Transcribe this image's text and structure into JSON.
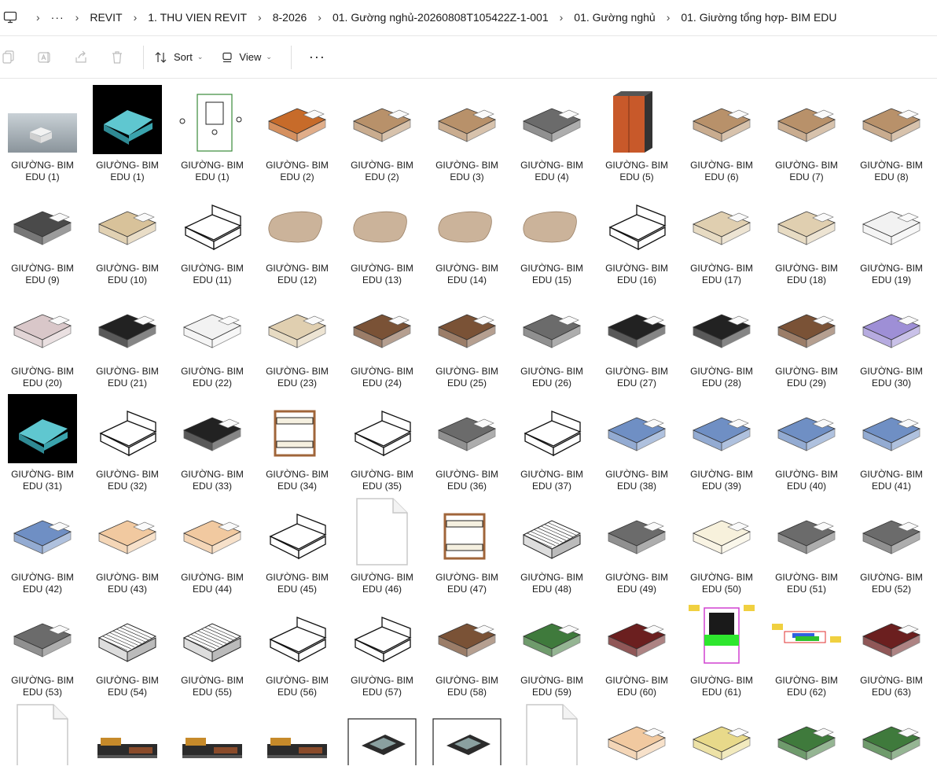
{
  "breadcrumb": {
    "items": [
      "REVIT",
      "1. THU VIEN REVIT",
      "8-2026",
      "01. Gường nghủ-20260808T105422Z-1-001",
      "01. Gường nghủ",
      "01. Giường tổng hợp- BIM EDU"
    ]
  },
  "toolbar": {
    "sort_label": "Sort",
    "view_label": "View",
    "more_label": "···"
  },
  "files": [
    {
      "line1": "GIƯỜNG- BIM",
      "line2": "EDU (1)",
      "kind": "photo"
    },
    {
      "line1": "GIƯỜNG- BIM",
      "line2": "EDU (1)",
      "kind": "dark"
    },
    {
      "line1": "GIƯỜNG- BIM",
      "line2": "EDU (1)",
      "kind": "plan"
    },
    {
      "line1": "GIƯỜNG- BIM",
      "line2": "EDU (2)",
      "kind": "orange"
    },
    {
      "line1": "GIƯỜNG- BIM",
      "line2": "EDU (2)",
      "kind": "wood"
    },
    {
      "line1": "GIƯỜNG- BIM",
      "line2": "EDU (3)",
      "kind": "wood"
    },
    {
      "line1": "GIƯỜNG- BIM",
      "line2": "EDU (4)",
      "kind": "grey"
    },
    {
      "line1": "GIƯỜNG- BIM",
      "line2": "EDU (5)",
      "kind": "cabinet"
    },
    {
      "line1": "GIƯỜNG- BIM",
      "line2": "EDU (6)",
      "kind": "wood"
    },
    {
      "line1": "GIƯỜNG- BIM",
      "line2": "EDU (7)",
      "kind": "wood"
    },
    {
      "line1": "GIƯỜNG- BIM",
      "line2": "EDU (8)",
      "kind": "wood"
    },
    {
      "line1": "GIƯỜNG- BIM",
      "line2": "EDU (9)",
      "kind": "dark-slab"
    },
    {
      "line1": "GIƯỜNG- BIM",
      "line2": "EDU (10)",
      "kind": "tan"
    },
    {
      "line1": "GIƯỜNG- BIM",
      "line2": "EDU (11)",
      "kind": "line"
    },
    {
      "line1": "GIƯỜNG- BIM",
      "line2": "EDU (12)",
      "kind": "pillow"
    },
    {
      "line1": "GIƯỜNG- BIM",
      "line2": "EDU (13)",
      "kind": "pillow"
    },
    {
      "line1": "GIƯỜNG- BIM",
      "line2": "EDU (14)",
      "kind": "pillow"
    },
    {
      "line1": "GIƯỜNG- BIM",
      "line2": "EDU (15)",
      "kind": "pillow"
    },
    {
      "line1": "GIƯỜNG- BIM",
      "line2": "EDU (16)",
      "kind": "line"
    },
    {
      "line1": "GIƯỜNG- BIM",
      "line2": "EDU (17)",
      "kind": "beige"
    },
    {
      "line1": "GIƯỜNG- BIM",
      "line2": "EDU (18)",
      "kind": "beige"
    },
    {
      "line1": "GIƯỜNG- BIM",
      "line2": "EDU (19)",
      "kind": "white"
    },
    {
      "line1": "GIƯỜNG- BIM",
      "line2": "EDU (20)",
      "kind": "pink"
    },
    {
      "line1": "GIƯỜNG- BIM",
      "line2": "EDU (21)",
      "kind": "black"
    },
    {
      "line1": "GIƯỜNG- BIM",
      "line2": "EDU (22)",
      "kind": "white"
    },
    {
      "line1": "GIƯỜNG- BIM",
      "line2": "EDU (23)",
      "kind": "beige"
    },
    {
      "line1": "GIƯỜNG- BIM",
      "line2": "EDU (24)",
      "kind": "brown"
    },
    {
      "line1": "GIƯỜNG- BIM",
      "line2": "EDU (25)",
      "kind": "brown"
    },
    {
      "line1": "GIƯỜNG- BIM",
      "line2": "EDU (26)",
      "kind": "grey"
    },
    {
      "line1": "GIƯỜNG- BIM",
      "line2": "EDU (27)",
      "kind": "black"
    },
    {
      "line1": "GIƯỜNG- BIM",
      "line2": "EDU (28)",
      "kind": "black"
    },
    {
      "line1": "GIƯỜNG- BIM",
      "line2": "EDU (29)",
      "kind": "brown"
    },
    {
      "line1": "GIƯỜNG- BIM",
      "line2": "EDU (30)",
      "kind": "purple"
    },
    {
      "line1": "GIƯỜNG- BIM",
      "line2": "EDU (31)",
      "kind": "dark"
    },
    {
      "line1": "GIƯỜNG- BIM",
      "line2": "EDU (32)",
      "kind": "line"
    },
    {
      "line1": "GIƯỜNG- BIM",
      "line2": "EDU (33)",
      "kind": "black"
    },
    {
      "line1": "GIƯỜNG- BIM",
      "line2": "EDU (34)",
      "kind": "bunk"
    },
    {
      "line1": "GIƯỜNG- BIM",
      "line2": "EDU (35)",
      "kind": "line"
    },
    {
      "line1": "GIƯỜNG- BIM",
      "line2": "EDU (36)",
      "kind": "grey"
    },
    {
      "line1": "GIƯỜNG- BIM",
      "line2": "EDU (37)",
      "kind": "line"
    },
    {
      "line1": "GIƯỜNG- BIM",
      "line2": "EDU (38)",
      "kind": "blue"
    },
    {
      "line1": "GIƯỜNG- BIM",
      "line2": "EDU (39)",
      "kind": "blue"
    },
    {
      "line1": "GIƯỜNG- BIM",
      "line2": "EDU (40)",
      "kind": "blue"
    },
    {
      "line1": "GIƯỜNG- BIM",
      "line2": "EDU (41)",
      "kind": "blue"
    },
    {
      "line1": "GIƯỜNG- BIM",
      "line2": "EDU (42)",
      "kind": "blue"
    },
    {
      "line1": "GIƯỜNG- BIM",
      "line2": "EDU (43)",
      "kind": "peach"
    },
    {
      "line1": "GIƯỜNG- BIM",
      "line2": "EDU (44)",
      "kind": "peach"
    },
    {
      "line1": "GIƯỜNG- BIM",
      "line2": "EDU (45)",
      "kind": "line"
    },
    {
      "line1": "GIƯỜNG- BIM",
      "line2": "EDU (46)",
      "kind": "file"
    },
    {
      "line1": "GIƯỜNG- BIM",
      "line2": "EDU (47)",
      "kind": "bunk"
    },
    {
      "line1": "GIƯỜNG- BIM",
      "line2": "EDU (48)",
      "kind": "mesh"
    },
    {
      "line1": "GIƯỜNG- BIM",
      "line2": "EDU (49)",
      "kind": "grey"
    },
    {
      "line1": "GIƯỜNG- BIM",
      "line2": "EDU (50)",
      "kind": "cream"
    },
    {
      "line1": "GIƯỜNG- BIM",
      "line2": "EDU (51)",
      "kind": "grey"
    },
    {
      "line1": "GIƯỜNG- BIM",
      "line2": "EDU (52)",
      "kind": "grey"
    },
    {
      "line1": "GIƯỜNG- BIM",
      "line2": "EDU (53)",
      "kind": "grey"
    },
    {
      "line1": "GIƯỜNG- BIM",
      "line2": "EDU (54)",
      "kind": "mesh"
    },
    {
      "line1": "GIƯỜNG- BIM",
      "line2": "EDU (55)",
      "kind": "mesh"
    },
    {
      "line1": "GIƯỜNG- BIM",
      "line2": "EDU (56)",
      "kind": "line"
    },
    {
      "line1": "GIƯỜNG- BIM",
      "line2": "EDU (57)",
      "kind": "line"
    },
    {
      "line1": "GIƯỜNG- BIM",
      "line2": "EDU (58)",
      "kind": "brown"
    },
    {
      "line1": "GIƯỜNG- BIM",
      "line2": "EDU (59)",
      "kind": "green"
    },
    {
      "line1": "GIƯỜNG- BIM",
      "line2": "EDU (60)",
      "kind": "maroon"
    },
    {
      "line1": "GIƯỜNG- BIM",
      "line2": "EDU (61)",
      "kind": "cad"
    },
    {
      "line1": "GIƯỜNG- BIM",
      "line2": "EDU (62)",
      "kind": "cad2"
    },
    {
      "line1": "GIƯỜNG- BIM",
      "line2": "EDU (63)",
      "kind": "maroon"
    },
    {
      "line1": "",
      "line2": "",
      "kind": "file"
    },
    {
      "line1": "",
      "line2": "",
      "kind": "sofa"
    },
    {
      "line1": "",
      "line2": "",
      "kind": "sofa"
    },
    {
      "line1": "",
      "line2": "",
      "kind": "sofa"
    },
    {
      "line1": "",
      "line2": "",
      "kind": "framed"
    },
    {
      "line1": "",
      "line2": "",
      "kind": "framed"
    },
    {
      "line1": "",
      "line2": "",
      "kind": "file"
    },
    {
      "line1": "",
      "line2": "",
      "kind": "peach"
    },
    {
      "line1": "",
      "line2": "",
      "kind": "yellow"
    },
    {
      "line1": "",
      "line2": "",
      "kind": "green"
    },
    {
      "line1": "",
      "line2": "",
      "kind": "green"
    }
  ],
  "palette": {
    "wood": "#b8916a",
    "dark": "#000000",
    "grey": "#6b6b6b",
    "blue": "#6f8fc4",
    "brown": "#7a5236",
    "green": "#3f7a3c",
    "maroon": "#6b1f1f",
    "cream": "#f7f1dc",
    "peach": "#f1c9a0",
    "tan": "#d8c29a",
    "pink": "#d9c7c9",
    "beige": "#e0cfb0",
    "purple": "#9e8fd6",
    "yellow": "#e8d98a"
  }
}
